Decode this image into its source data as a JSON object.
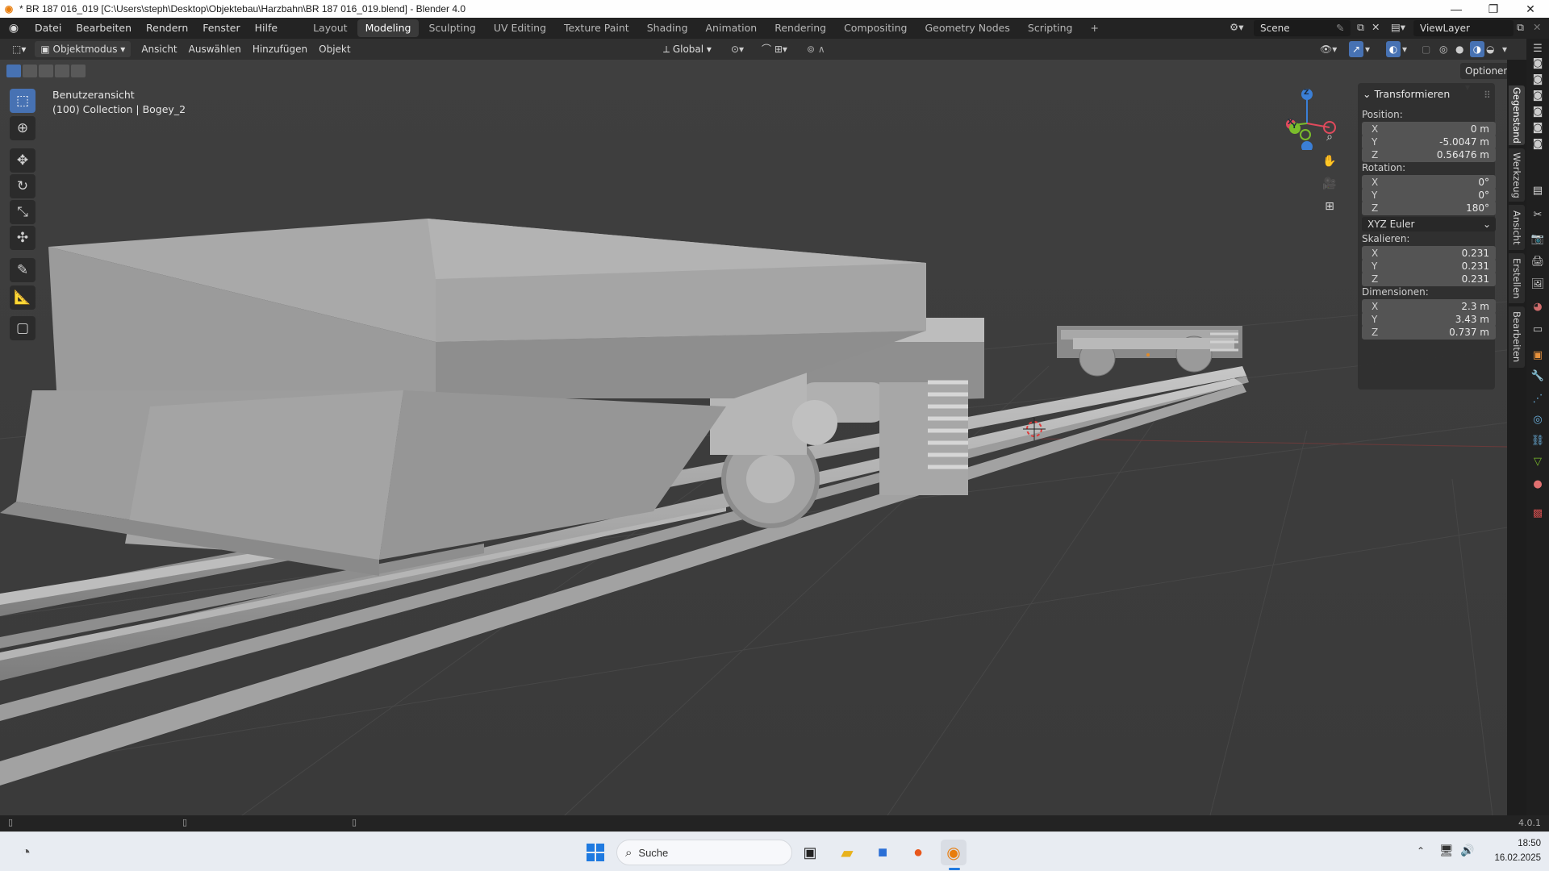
{
  "window": {
    "title": "* BR 187 016_019 [C:\\Users\\steph\\Desktop\\Objektebau\\Harzbahn\\BR 187 016_019.blend] - Blender 4.0",
    "minimize": "—",
    "maximize": "❐",
    "close": "✕"
  },
  "menu": [
    "Datei",
    "Bearbeiten",
    "Rendern",
    "Fenster",
    "Hilfe"
  ],
  "workspaces": [
    "Layout",
    "Modeling",
    "Sculpting",
    "UV Editing",
    "Texture Paint",
    "Shading",
    "Animation",
    "Rendering",
    "Compositing",
    "Geometry Nodes",
    "Scripting",
    "+"
  ],
  "active_workspace": "Modeling",
  "scene": "Scene",
  "view_layer": "ViewLayer",
  "header": {
    "mode": "Objektmodus",
    "menus": [
      "Ansicht",
      "Auswählen",
      "Hinzufügen",
      "Objekt"
    ],
    "orientation": "Global",
    "options": "Optionen"
  },
  "viewport": {
    "view_name": "Benutzeransicht",
    "collection_info": "(100) Collection | Bogey_2",
    "gizmo_axes": [
      "Z",
      "Y",
      "X"
    ]
  },
  "npanel": {
    "section": "Transformieren",
    "position_label": "Position:",
    "position": [
      {
        "axis": "X",
        "value": "0 m"
      },
      {
        "axis": "Y",
        "value": "-5.0047 m"
      },
      {
        "axis": "Z",
        "value": "0.56476 m"
      }
    ],
    "rotation_label": "Rotation:",
    "rotation": [
      {
        "axis": "X",
        "value": "0°"
      },
      {
        "axis": "Y",
        "value": "0°"
      },
      {
        "axis": "Z",
        "value": "180°"
      }
    ],
    "rotation_mode": "XYZ Euler",
    "scale_label": "Skalieren:",
    "scale": [
      {
        "axis": "X",
        "value": "0.231"
      },
      {
        "axis": "Y",
        "value": "0.231"
      },
      {
        "axis": "Z",
        "value": "0.231"
      }
    ],
    "dimensions_label": "Dimensionen:",
    "dimensions": [
      {
        "axis": "X",
        "value": "2.3 m"
      },
      {
        "axis": "Y",
        "value": "3.43 m"
      },
      {
        "axis": "Z",
        "value": "0.737 m"
      }
    ]
  },
  "side_tabs": [
    "Gegenstand",
    "Werkzeug",
    "Ansicht",
    "Erstellen",
    "Bearbeiten"
  ],
  "status": {
    "version": "4.0.1"
  },
  "taskbar": {
    "search_placeholder": "Suche",
    "time": "18:50",
    "date": "16.02.2025"
  },
  "colors": {
    "accent": "#4772b3",
    "axis_x": "#e04a5c",
    "axis_y": "#7bbd2b",
    "axis_z": "#3b7fd6",
    "blender_orange": "#e87d0d"
  }
}
